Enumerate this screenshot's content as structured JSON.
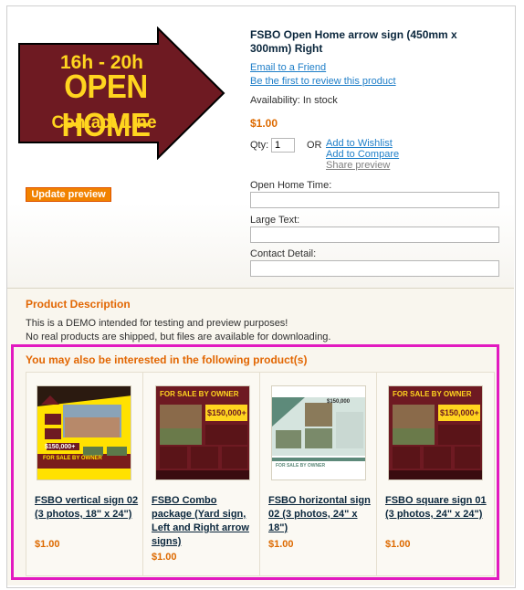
{
  "product": {
    "title": "FSBO Open Home arrow sign (450mm x 300mm) Right",
    "email_friend": "Email to a Friend",
    "review_link": "Be the first to review this product",
    "availability": "Availability: In stock",
    "price": "$1.00",
    "qty_label": "Qty:",
    "qty_value": "1",
    "or_label": "OR",
    "add_wishlist": "Add to Wishlist",
    "add_compare": "Add to Compare",
    "share_preview": "Share preview",
    "update_preview": "Update preview",
    "sign_text": {
      "line1": "16h - 20h",
      "line2": "OPEN HOME",
      "line3": "Contact Line"
    },
    "options": [
      {
        "label": "Open Home Time:",
        "value": ""
      },
      {
        "label": "Large Text:",
        "value": ""
      },
      {
        "label": "Contact Detail:",
        "value": ""
      }
    ]
  },
  "description": {
    "title": "Product Description",
    "lines": [
      "This is a DEMO intended for testing and preview purposes!",
      "No real products are shipped, but files are available for downloading."
    ]
  },
  "related": {
    "title": "You may also be interested in the following product(s)",
    "items": [
      {
        "name": "FSBO vertical sign 02 (3 photos, 18\" x 24\")",
        "price": "$1.00",
        "thumb_heading": "FOR SALE BY OWNER",
        "thumb_price": "$150,000+"
      },
      {
        "name": "FSBO Combo package (Yard sign, Left and Right arrow signs)",
        "price": "$1.00",
        "thumb_heading": "FOR SALE BY OWNER",
        "thumb_price": "$150,000+"
      },
      {
        "name": "FSBO horizontal sign 02 (3 photos, 24\" x 18\")",
        "price": "$1.00",
        "thumb_heading": "FOR SALE BY OWNER",
        "thumb_price": "$150,000"
      },
      {
        "name": "FSBO square sign 01 (3 photos, 24\" x 24\")",
        "price": "$1.00",
        "thumb_heading": "FOR SALE BY OWNER",
        "thumb_price": "$150,000+"
      }
    ]
  },
  "colors": {
    "accent": "#e26703",
    "link": "#1e7ec8",
    "sign_fill": "#6e1a22",
    "sign_text": "#ffd51f",
    "highlight": "#e21ac0"
  }
}
